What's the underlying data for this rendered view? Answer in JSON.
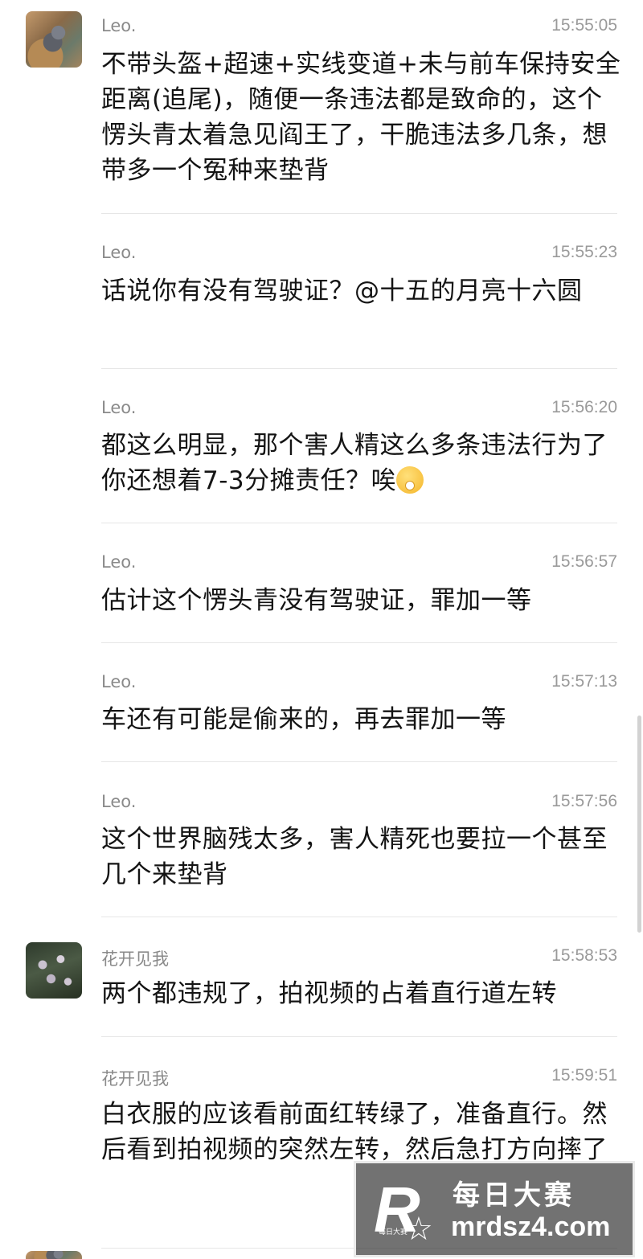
{
  "messages": [
    {
      "name": "Leo.",
      "time": "15:55:05",
      "text": "不带头盔+超速+实线变道+未与前车保持安全距离(追尾)，随便一条违法都是致命的，这个愣头青太着急见阎王了，干脆违法多几条，想带多一个冤种来垫背"
    },
    {
      "name": "Leo.",
      "time": "15:55:23",
      "text": "话说你有没有驾驶证？@十五的月亮十六圆"
    },
    {
      "name": "Leo.",
      "time": "15:56:20",
      "text": "都这么明显，那个害人精这么多条违法行为了你还想着7-3分摊责任？唉"
    },
    {
      "name": "Leo.",
      "time": "15:56:57",
      "text": "估计这个愣头青没有驾驶证，罪加一等"
    },
    {
      "name": "Leo.",
      "time": "15:57:13",
      "text": "车还有可能是偷来的，再去罪加一等"
    },
    {
      "name": "Leo.",
      "time": "15:57:56",
      "text": "这个世界脑残太多，害人精死也要拉一个甚至几个来垫背"
    },
    {
      "name": "花开见我",
      "time": "15:58:53",
      "text": "两个都违规了，拍视频的占着直行道左转"
    },
    {
      "name": "花开见我",
      "time": "15:59:51",
      "text": "白衣服的应该看前面红转绿了，准备直行。然后看到拍视频的突然左转，然后急打方向摔了"
    }
  ],
  "emoji_icon": "thinking-face-emoji",
  "watermark": {
    "logo_letter": "R",
    "logo_small": "每日大赛",
    "title": "每日大赛",
    "url": "mrdsz4.com"
  }
}
